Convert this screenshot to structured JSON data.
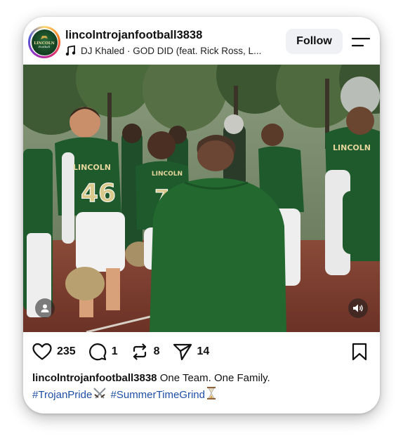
{
  "post": {
    "username": "lincolntrojanfootball3838",
    "avatar_logo_text": "LINCOLN",
    "music": "DJ Khaled · GOD DID (feat. Rick Ross, L...",
    "follow_label": "Follow",
    "photo_jersey_numbers": [
      "46",
      "71"
    ],
    "photo_jersey_text": "LINCOLN",
    "actions": {
      "likes": "235",
      "comments": "1",
      "reposts": "8",
      "shares": "14"
    },
    "caption": {
      "username": "lincolntrojanfootball3838",
      "text": "One Team. One Family.",
      "hashtag1": "#TrojanPride",
      "hashtag2": "#SummerTimeGrind"
    }
  },
  "colors": {
    "jersey_green": "#1f5a2c",
    "hashtag_blue": "#1e4fa6",
    "track_red": "#7a3a2e"
  },
  "icons": [
    "music-note-icon",
    "menu-icon",
    "user-tag-icon",
    "sound-icon",
    "heart-icon",
    "comment-icon",
    "repost-icon",
    "share-icon",
    "bookmark-icon",
    "crossed-swords-emoji",
    "hourglass-emoji"
  ]
}
